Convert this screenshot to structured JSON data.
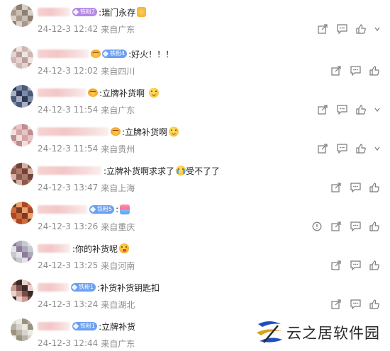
{
  "comments": [
    {
      "text": ":瑞门永存",
      "badge": "铁粉2",
      "date": "24-12-3",
      "time": "12:42",
      "location": "来自广东",
      "actions": [
        "share",
        "reply",
        "like",
        "more"
      ],
      "emoji": "thumb"
    },
    {
      "text": ":好火！！！",
      "badge": "铁粉4",
      "date": "24-12-3",
      "time": "12:02",
      "location": "来自四川",
      "actions": [
        "share",
        "reply",
        "like"
      ],
      "emoji": ""
    },
    {
      "text": ":立牌补货啊",
      "badge": "",
      "date": "24-12-3",
      "time": "11:54",
      "location": "来自广东",
      "actions": [
        "share",
        "reply",
        "like",
        "more"
      ],
      "emoji": "smile"
    },
    {
      "text": ":立牌补货啊",
      "badge": "",
      "date": "24-12-3",
      "time": "11:54",
      "location": "来自贵州",
      "actions": [
        "share",
        "reply",
        "like",
        "more"
      ],
      "emoji": "smile"
    },
    {
      "text": ":立牌补货啊求求了",
      "text_tail": "受不了了",
      "badge": "",
      "date": "24-12-3",
      "time": "13:47",
      "location": "来自上海",
      "actions": [
        "share",
        "reply",
        "like"
      ],
      "emoji": "cry"
    },
    {
      "text": ":",
      "badge": "铁粉5",
      "date": "24-12-3",
      "time": "13:26",
      "location": "来自重庆",
      "actions": [
        "report",
        "share",
        "reply",
        "like"
      ],
      "emoji": "gift"
    },
    {
      "text": ":你的补货呢",
      "badge": "",
      "date": "24-12-3",
      "time": "13:25",
      "location": "来自河南",
      "actions": [
        "share",
        "reply",
        "like"
      ],
      "emoji": "tongue"
    },
    {
      "text": ":补货补货钥匙扣",
      "badge": "铁粉1",
      "date": "24-12-3",
      "time": "13:24",
      "location": "来自湖北",
      "actions": [
        "share",
        "reply",
        "like"
      ],
      "emoji": ""
    },
    {
      "text": ":立牌补货",
      "badge": "铁粉1",
      "date": "24-12-3",
      "time": "12:44",
      "location": "来自广东",
      "actions": [],
      "emoji": ""
    }
  ],
  "watermark": {
    "text": "云之居软件园"
  }
}
